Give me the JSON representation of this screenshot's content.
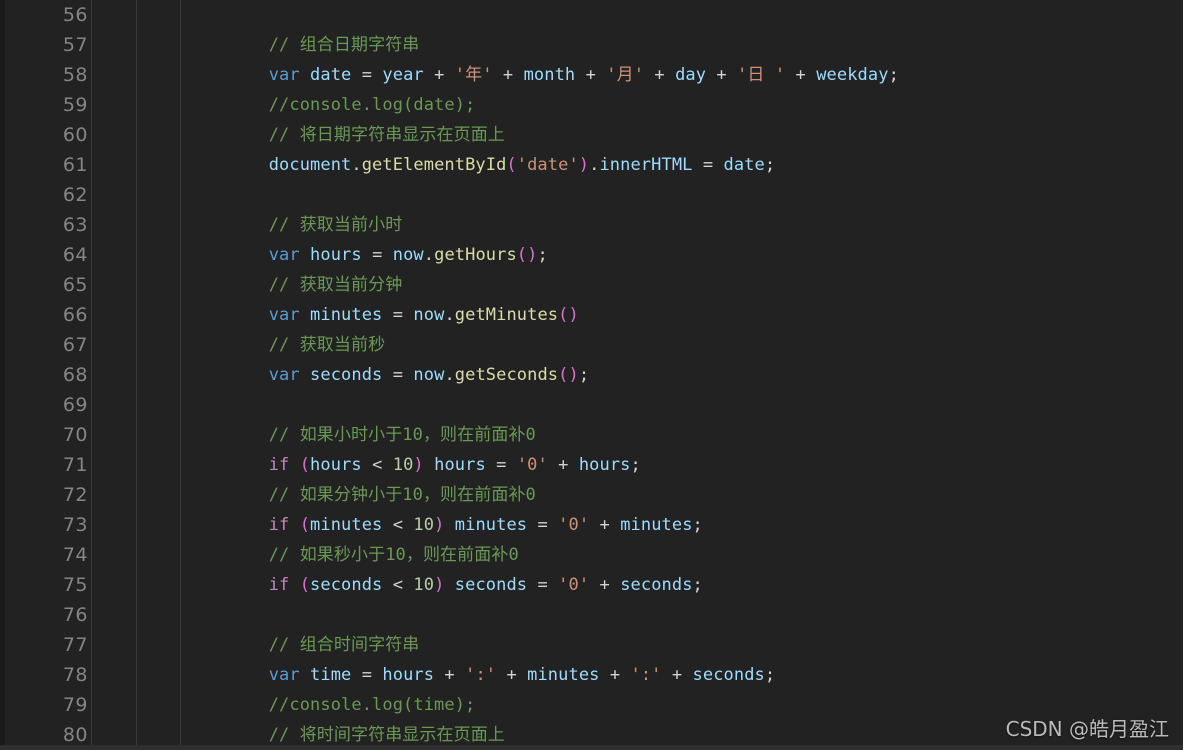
{
  "editor": {
    "background_color": "#222222",
    "gutter_color": "#1a1a1a",
    "language": "javascript",
    "first_line_number": 56,
    "last_line_number": 80,
    "indent_text": "        "
  },
  "colors": {
    "comment": "#6a9955",
    "keyword": "#569cd6",
    "control": "#c586c0",
    "variable": "#9cdcfe",
    "function": "#dcdcaa",
    "string": "#ce9178",
    "number": "#b5cea8",
    "punctuation": "#d4d4d4",
    "paren": "#da70d6",
    "line_number": "#858585",
    "separator": "#3a3a3a"
  },
  "watermark": {
    "text": "CSDN @皓月盈江"
  },
  "lines": [
    {
      "number": "56",
      "tokens": []
    },
    {
      "number": "57",
      "tokens": [
        {
          "t": "// 组合日期字符串",
          "c": "t-com"
        }
      ]
    },
    {
      "number": "58",
      "tokens": [
        {
          "t": "var",
          "c": "t-kw"
        },
        {
          "t": " ",
          "c": "t-pun"
        },
        {
          "t": "date",
          "c": "t-var"
        },
        {
          "t": " = ",
          "c": "t-pun"
        },
        {
          "t": "year",
          "c": "t-var"
        },
        {
          "t": " + ",
          "c": "t-pun"
        },
        {
          "t": "'年'",
          "c": "t-str"
        },
        {
          "t": " + ",
          "c": "t-pun"
        },
        {
          "t": "month",
          "c": "t-var"
        },
        {
          "t": " + ",
          "c": "t-pun"
        },
        {
          "t": "'月'",
          "c": "t-str"
        },
        {
          "t": " + ",
          "c": "t-pun"
        },
        {
          "t": "day",
          "c": "t-var"
        },
        {
          "t": " + ",
          "c": "t-pun"
        },
        {
          "t": "'日 '",
          "c": "t-str"
        },
        {
          "t": " + ",
          "c": "t-pun"
        },
        {
          "t": "weekday",
          "c": "t-var"
        },
        {
          "t": ";",
          "c": "t-pun"
        }
      ]
    },
    {
      "number": "59",
      "tokens": [
        {
          "t": "//console.log(date);",
          "c": "t-com"
        }
      ]
    },
    {
      "number": "60",
      "tokens": [
        {
          "t": "// 将日期字符串显示在页面上",
          "c": "t-com"
        }
      ]
    },
    {
      "number": "61",
      "tokens": [
        {
          "t": "document",
          "c": "t-var"
        },
        {
          "t": ".",
          "c": "t-pun"
        },
        {
          "t": "getElementById",
          "c": "t-fn"
        },
        {
          "t": "(",
          "c": "t-par"
        },
        {
          "t": "'date'",
          "c": "t-str"
        },
        {
          "t": ")",
          "c": "t-par"
        },
        {
          "t": ".",
          "c": "t-pun"
        },
        {
          "t": "innerHTML",
          "c": "t-prop"
        },
        {
          "t": " = ",
          "c": "t-pun"
        },
        {
          "t": "date",
          "c": "t-var"
        },
        {
          "t": ";",
          "c": "t-pun"
        }
      ]
    },
    {
      "number": "62",
      "tokens": []
    },
    {
      "number": "63",
      "tokens": [
        {
          "t": "// 获取当前小时",
          "c": "t-com"
        }
      ]
    },
    {
      "number": "64",
      "tokens": [
        {
          "t": "var",
          "c": "t-kw"
        },
        {
          "t": " ",
          "c": "t-pun"
        },
        {
          "t": "hours",
          "c": "t-var"
        },
        {
          "t": " = ",
          "c": "t-pun"
        },
        {
          "t": "now",
          "c": "t-var"
        },
        {
          "t": ".",
          "c": "t-pun"
        },
        {
          "t": "getHours",
          "c": "t-fn"
        },
        {
          "t": "()",
          "c": "t-par"
        },
        {
          "t": ";",
          "c": "t-pun"
        }
      ]
    },
    {
      "number": "65",
      "tokens": [
        {
          "t": "// 获取当前分钟",
          "c": "t-com"
        }
      ]
    },
    {
      "number": "66",
      "tokens": [
        {
          "t": "var",
          "c": "t-kw"
        },
        {
          "t": " ",
          "c": "t-pun"
        },
        {
          "t": "minutes",
          "c": "t-var"
        },
        {
          "t": " = ",
          "c": "t-pun"
        },
        {
          "t": "now",
          "c": "t-var"
        },
        {
          "t": ".",
          "c": "t-pun"
        },
        {
          "t": "getMinutes",
          "c": "t-fn"
        },
        {
          "t": "()",
          "c": "t-par"
        }
      ]
    },
    {
      "number": "67",
      "tokens": [
        {
          "t": "// 获取当前秒",
          "c": "t-com"
        }
      ]
    },
    {
      "number": "68",
      "tokens": [
        {
          "t": "var",
          "c": "t-kw"
        },
        {
          "t": " ",
          "c": "t-pun"
        },
        {
          "t": "seconds",
          "c": "t-var"
        },
        {
          "t": " = ",
          "c": "t-pun"
        },
        {
          "t": "now",
          "c": "t-var"
        },
        {
          "t": ".",
          "c": "t-pun"
        },
        {
          "t": "getSeconds",
          "c": "t-fn"
        },
        {
          "t": "()",
          "c": "t-par"
        },
        {
          "t": ";",
          "c": "t-pun"
        }
      ]
    },
    {
      "number": "69",
      "tokens": []
    },
    {
      "number": "70",
      "tokens": [
        {
          "t": "// 如果小时小于10，则在前面补0",
          "c": "t-com"
        }
      ]
    },
    {
      "number": "71",
      "tokens": [
        {
          "t": "if",
          "c": "t-ctl"
        },
        {
          "t": " ",
          "c": "t-pun"
        },
        {
          "t": "(",
          "c": "t-par"
        },
        {
          "t": "hours",
          "c": "t-var"
        },
        {
          "t": " < ",
          "c": "t-pun"
        },
        {
          "t": "10",
          "c": "t-num"
        },
        {
          "t": ")",
          "c": "t-par"
        },
        {
          "t": " ",
          "c": "t-pun"
        },
        {
          "t": "hours",
          "c": "t-var"
        },
        {
          "t": " = ",
          "c": "t-pun"
        },
        {
          "t": "'0'",
          "c": "t-str"
        },
        {
          "t": " + ",
          "c": "t-pun"
        },
        {
          "t": "hours",
          "c": "t-var"
        },
        {
          "t": ";",
          "c": "t-pun"
        }
      ]
    },
    {
      "number": "72",
      "tokens": [
        {
          "t": "// 如果分钟小于10，则在前面补0",
          "c": "t-com"
        }
      ]
    },
    {
      "number": "73",
      "tokens": [
        {
          "t": "if",
          "c": "t-ctl"
        },
        {
          "t": " ",
          "c": "t-pun"
        },
        {
          "t": "(",
          "c": "t-par"
        },
        {
          "t": "minutes",
          "c": "t-var"
        },
        {
          "t": " < ",
          "c": "t-pun"
        },
        {
          "t": "10",
          "c": "t-num"
        },
        {
          "t": ")",
          "c": "t-par"
        },
        {
          "t": " ",
          "c": "t-pun"
        },
        {
          "t": "minutes",
          "c": "t-var"
        },
        {
          "t": " = ",
          "c": "t-pun"
        },
        {
          "t": "'0'",
          "c": "t-str"
        },
        {
          "t": " + ",
          "c": "t-pun"
        },
        {
          "t": "minutes",
          "c": "t-var"
        },
        {
          "t": ";",
          "c": "t-pun"
        }
      ]
    },
    {
      "number": "74",
      "tokens": [
        {
          "t": "// 如果秒小于10，则在前面补0",
          "c": "t-com"
        }
      ]
    },
    {
      "number": "75",
      "tokens": [
        {
          "t": "if",
          "c": "t-ctl"
        },
        {
          "t": " ",
          "c": "t-pun"
        },
        {
          "t": "(",
          "c": "t-par"
        },
        {
          "t": "seconds",
          "c": "t-var"
        },
        {
          "t": " < ",
          "c": "t-pun"
        },
        {
          "t": "10",
          "c": "t-num"
        },
        {
          "t": ")",
          "c": "t-par"
        },
        {
          "t": " ",
          "c": "t-pun"
        },
        {
          "t": "seconds",
          "c": "t-var"
        },
        {
          "t": " = ",
          "c": "t-pun"
        },
        {
          "t": "'0'",
          "c": "t-str"
        },
        {
          "t": " + ",
          "c": "t-pun"
        },
        {
          "t": "seconds",
          "c": "t-var"
        },
        {
          "t": ";",
          "c": "t-pun"
        }
      ]
    },
    {
      "number": "76",
      "tokens": []
    },
    {
      "number": "77",
      "tokens": [
        {
          "t": "// 组合时间字符串",
          "c": "t-com"
        }
      ]
    },
    {
      "number": "78",
      "tokens": [
        {
          "t": "var",
          "c": "t-kw"
        },
        {
          "t": " ",
          "c": "t-pun"
        },
        {
          "t": "time",
          "c": "t-var"
        },
        {
          "t": " = ",
          "c": "t-pun"
        },
        {
          "t": "hours",
          "c": "t-var"
        },
        {
          "t": " + ",
          "c": "t-pun"
        },
        {
          "t": "':'",
          "c": "t-str"
        },
        {
          "t": " + ",
          "c": "t-pun"
        },
        {
          "t": "minutes",
          "c": "t-var"
        },
        {
          "t": " + ",
          "c": "t-pun"
        },
        {
          "t": "':'",
          "c": "t-str"
        },
        {
          "t": " + ",
          "c": "t-pun"
        },
        {
          "t": "seconds",
          "c": "t-var"
        },
        {
          "t": ";",
          "c": "t-pun"
        }
      ]
    },
    {
      "number": "79",
      "tokens": [
        {
          "t": "//console.log(time);",
          "c": "t-com"
        }
      ]
    },
    {
      "number": "80",
      "tokens": [
        {
          "t": "// 将时间字符串显示在页面上",
          "c": "t-com"
        }
      ]
    }
  ]
}
